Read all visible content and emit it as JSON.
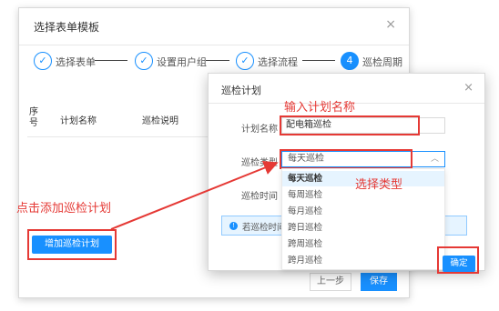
{
  "bg_dialog": {
    "title": "选择表单模板",
    "close": "×",
    "steps": [
      {
        "icon": "✓",
        "label": "选择表单"
      },
      {
        "icon": "✓",
        "label": "设置用户组"
      },
      {
        "icon": "✓",
        "label": "选择流程"
      },
      {
        "icon": "4",
        "label": "巡检周期"
      }
    ],
    "table_headers": {
      "no": "序号",
      "name": "计划名称",
      "desc": "巡检说明"
    },
    "add_button": "增加巡检计划",
    "prev_button": "上一步",
    "ok_button": "保存"
  },
  "fg_dialog": {
    "title": "巡检计划",
    "close": "×",
    "name_label": "计划名称",
    "name_value": "配电箱巡检",
    "type_label": "巡检类型",
    "type_value": "每天巡检",
    "time_label": "巡检时间",
    "options": [
      "每天巡检",
      "每周巡检",
      "每月巡检",
      "跨日巡检",
      "跨周巡检",
      "跨月巡检"
    ],
    "info_text": "若巡检时间为",
    "ok_button": "确定"
  },
  "annotations": {
    "name_hint": "输入计划名称",
    "type_hint": "选择类型",
    "add_hint": "点击添加巡检计划"
  },
  "colors": {
    "primary": "#1890ff",
    "annotation": "#e53935"
  }
}
